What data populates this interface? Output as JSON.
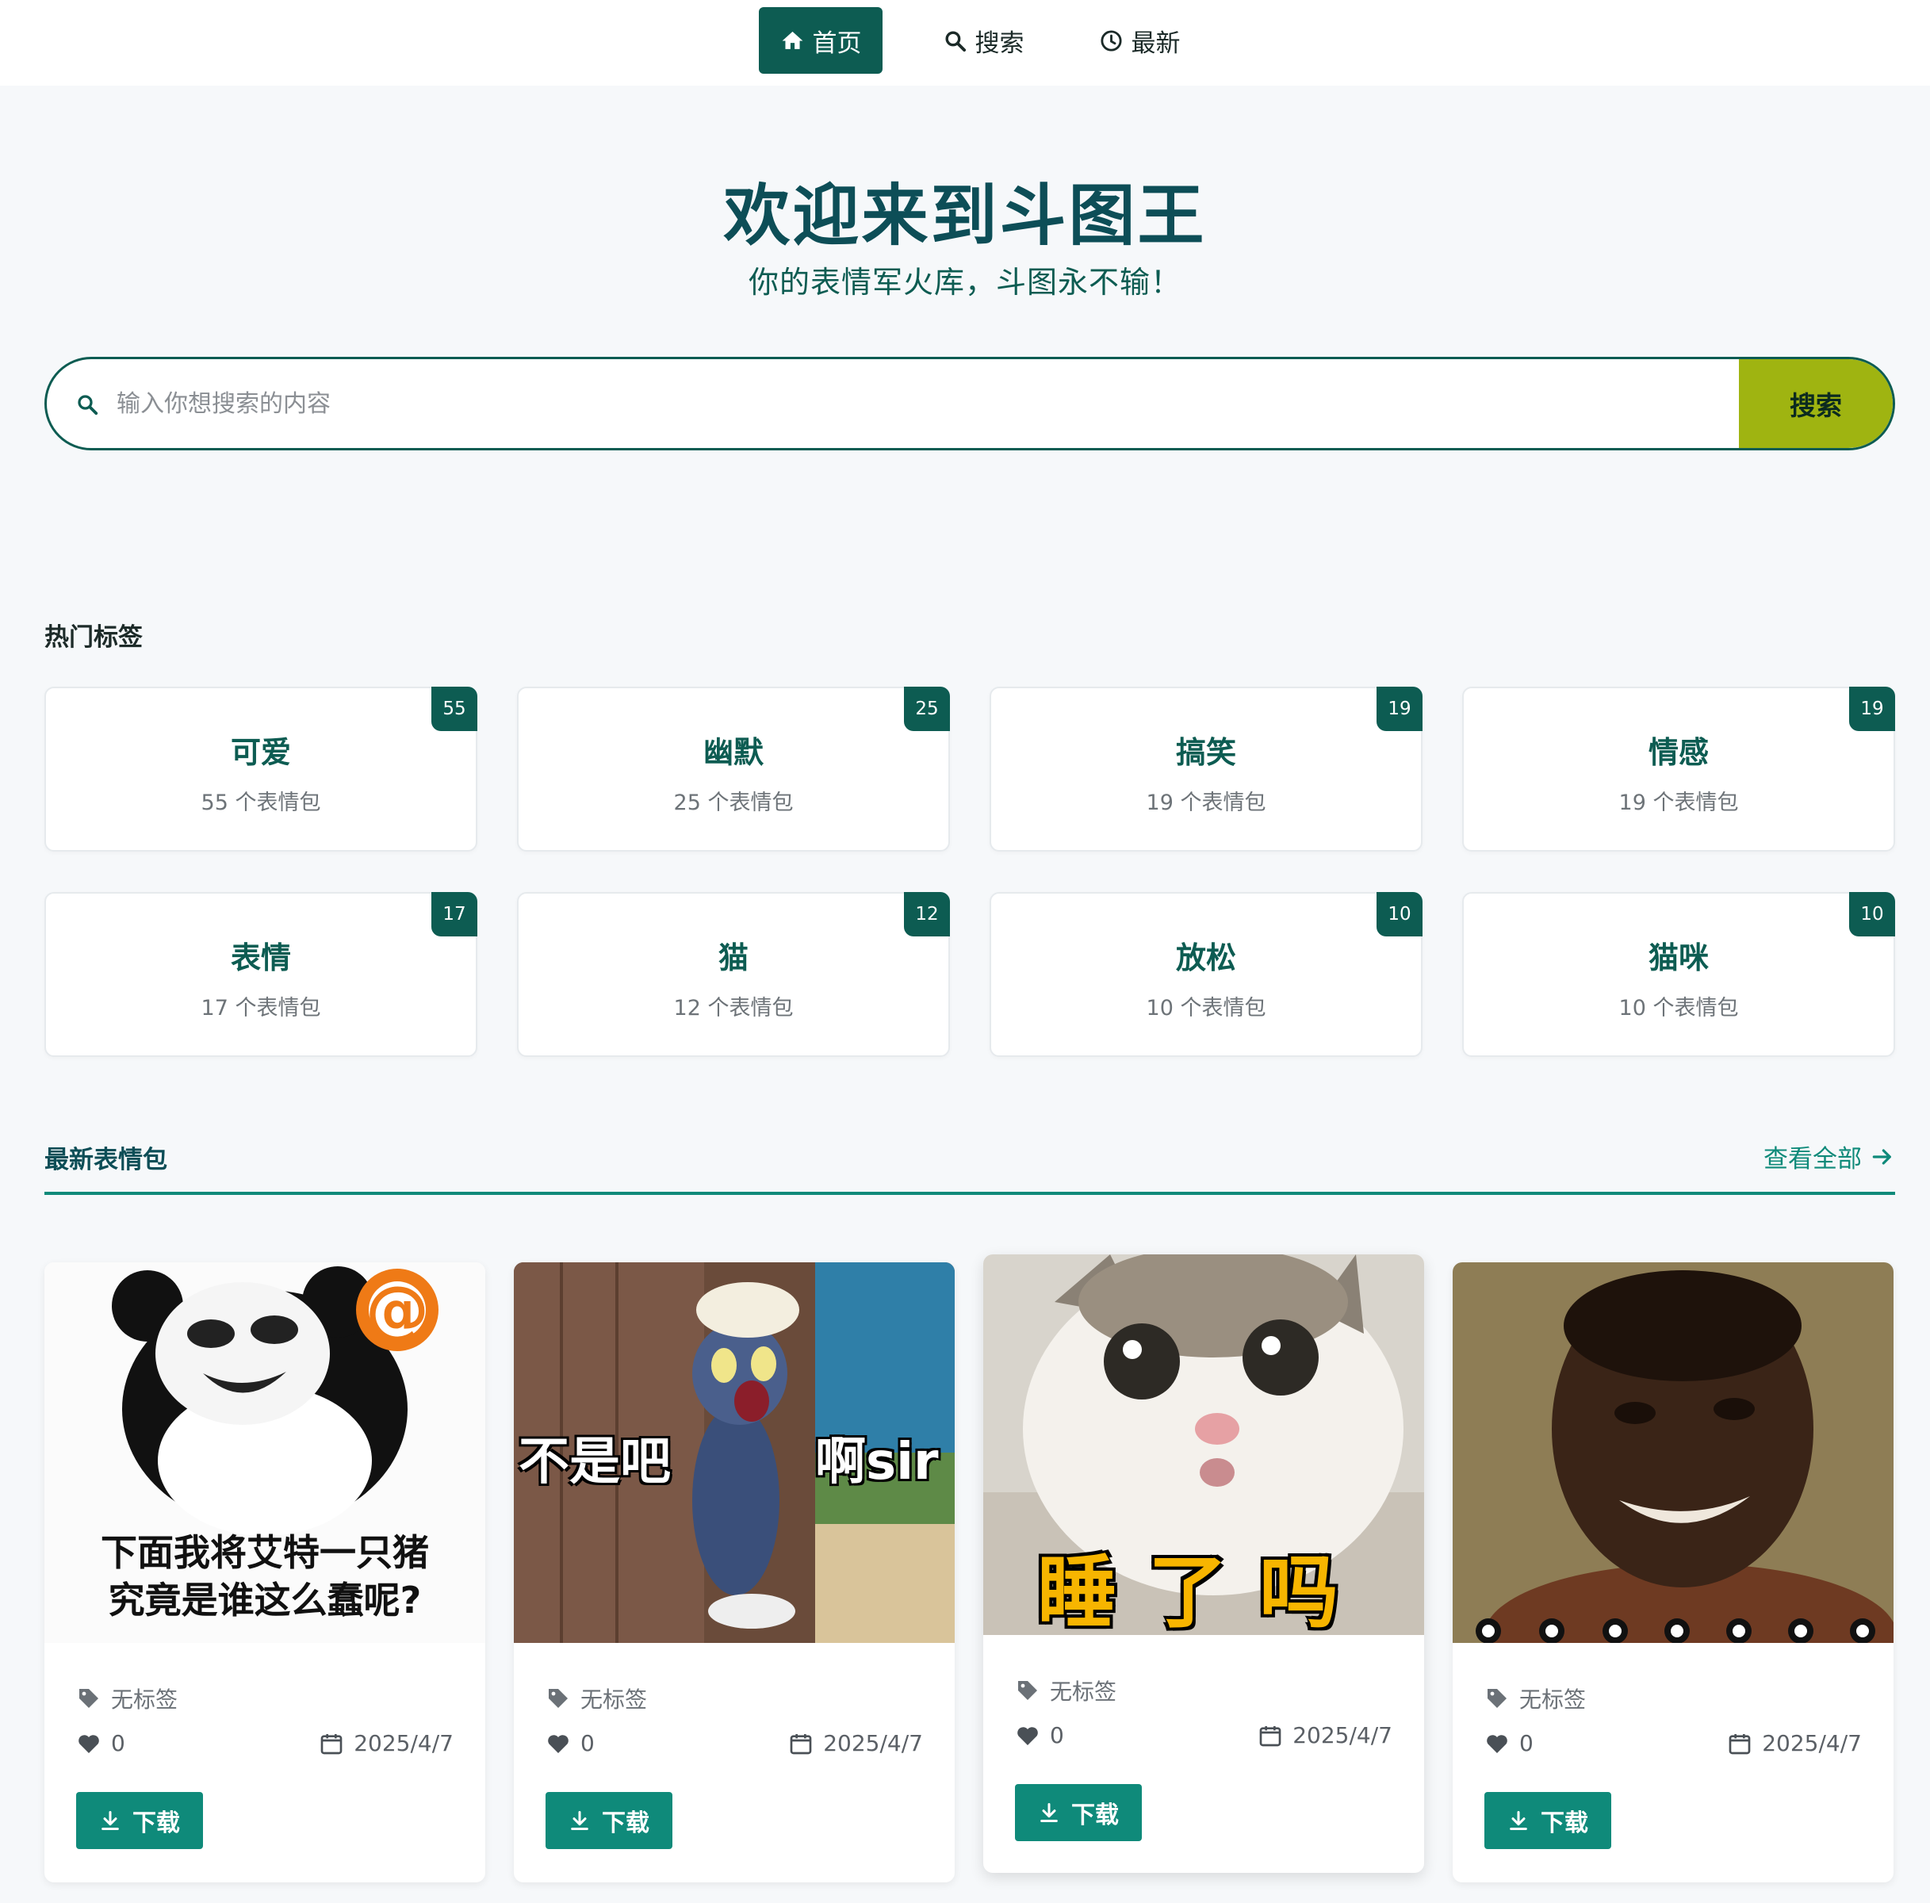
{
  "nav": {
    "items": [
      {
        "label": "首页",
        "icon": "home-icon",
        "active": true
      },
      {
        "label": "搜索",
        "icon": "search-icon",
        "active": false
      },
      {
        "label": "最新",
        "icon": "clock-icon",
        "active": false
      }
    ]
  },
  "hero": {
    "title": "欢迎来到斗图王",
    "subtitle": "你的表情军火库，斗图永不输！"
  },
  "search": {
    "placeholder": "输入你想搜索的内容",
    "value": "",
    "button_label": "搜索"
  },
  "tags_section": {
    "title": "热门标签",
    "tags": [
      {
        "name": "可爱",
        "count_text": "55 个表情包",
        "badge": "55"
      },
      {
        "name": "幽默",
        "count_text": "25 个表情包",
        "badge": "25"
      },
      {
        "name": "搞笑",
        "count_text": "19 个表情包",
        "badge": "19"
      },
      {
        "name": "情感",
        "count_text": "19 个表情包",
        "badge": "19"
      },
      {
        "name": "表情",
        "count_text": "17 个表情包",
        "badge": "17"
      },
      {
        "name": "猫",
        "count_text": "12 个表情包",
        "badge": "12"
      },
      {
        "name": "放松",
        "count_text": "10 个表情包",
        "badge": "10"
      },
      {
        "name": "猫咪",
        "count_text": "10 个表情包",
        "badge": "10"
      }
    ]
  },
  "latest_section": {
    "title": "最新表情包",
    "view_all": "查看全部",
    "memes": [
      {
        "image": "panda-meme-image",
        "caption_line1": "下面我将艾特一只猪",
        "caption_line2": "究竟是谁这么蠢呢?",
        "badge_symbol": "@",
        "tag": "无标签",
        "likes": "0",
        "date": "2025/4/7",
        "download_label": "下载"
      },
      {
        "image": "tom-cat-meme-image",
        "caption_left": "不是吧",
        "caption_right": "啊sir",
        "tag": "无标签",
        "likes": "0",
        "date": "2025/4/7",
        "download_label": "下载"
      },
      {
        "image": "surprised-cat-meme-image",
        "caption": "睡了吗",
        "tag": "无标签",
        "likes": "0",
        "date": "2025/4/7",
        "download_label": "下载"
      },
      {
        "image": "smiling-man-meme-image",
        "tag": "无标签",
        "likes": "0",
        "date": "2025/4/7",
        "download_label": "下载"
      }
    ]
  },
  "colors": {
    "primary": "#0d5c52",
    "accent": "#0f8a7a",
    "search_button": "#9fb411",
    "background": "#f6f8fa"
  }
}
